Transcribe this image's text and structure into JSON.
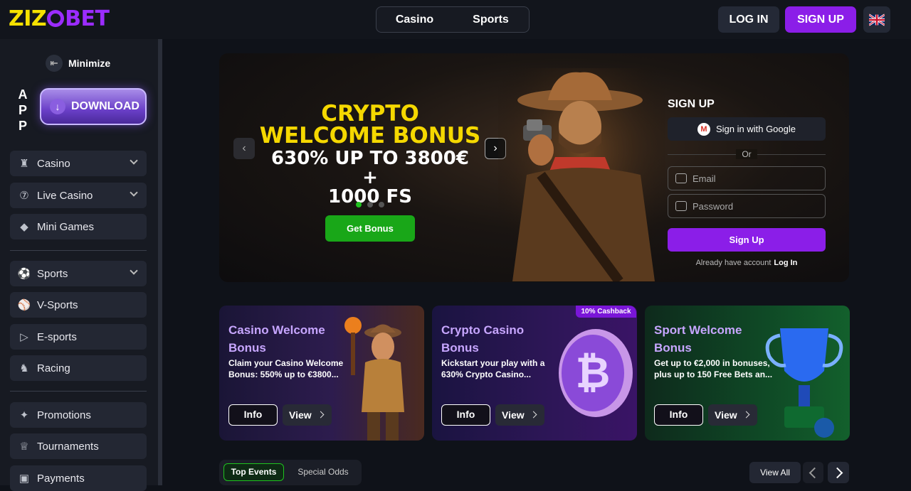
{
  "header": {
    "logo": {
      "part1": "ZIZ",
      "part2": "BET"
    },
    "nav_tabs": [
      "Casino",
      "Sports"
    ],
    "login_label": "LOG IN",
    "signup_label": "SIGN UP"
  },
  "sidebar": {
    "minimize_label": "Minimize",
    "app_letters": [
      "A",
      "P",
      "P"
    ],
    "download_label": "DOWNLOAD",
    "groups": [
      [
        {
          "label": "Casino",
          "icon": "casino-icon",
          "expandable": true
        },
        {
          "label": "Live Casino",
          "icon": "live-casino-icon",
          "expandable": true
        },
        {
          "label": "Mini Games",
          "icon": "diamond-icon",
          "expandable": false
        }
      ],
      [
        {
          "label": "Sports",
          "icon": "soccer-ball-icon",
          "expandable": true
        },
        {
          "label": "V-Sports",
          "icon": "virtual-sports-icon",
          "expandable": false
        },
        {
          "label": "E-sports",
          "icon": "play-icon",
          "expandable": false
        },
        {
          "label": "Racing",
          "icon": "horse-icon",
          "expandable": false
        }
      ],
      [
        {
          "label": "Promotions",
          "icon": "megaphone-icon",
          "expandable": false
        },
        {
          "label": "Tournaments",
          "icon": "trophy-icon",
          "expandable": false
        },
        {
          "label": "Payments",
          "icon": "wallet-icon",
          "expandable": false
        }
      ]
    ]
  },
  "hero": {
    "title_line1": "CRYPTO",
    "title_line2": "WELCOME BONUS",
    "subtitle_line1": "630% UP TO 3800€ +",
    "subtitle_line2": "1000 FS",
    "cta_label": "Get Bonus",
    "slides_total": 3,
    "active_slide": 1
  },
  "signup_form": {
    "title": "SIGN UP",
    "google_label": "Sign in with Google",
    "or_label": "Or",
    "email_placeholder": "Email",
    "password_placeholder": "Password",
    "submit_label": "Sign Up",
    "already_text": "Already have account",
    "login_link": "Log In"
  },
  "promo_cards": [
    {
      "title": "Casino Welcome Bonus",
      "desc": "Claim your Casino Welcome Bonus: 550% up to €3800...",
      "info_label": "Info",
      "view_label": "View"
    },
    {
      "title": "Crypto Casino Bonus",
      "desc": "Kickstart your play with a 630% Crypto Casino...",
      "info_label": "Info",
      "view_label": "View",
      "badge": "10% Cashback"
    },
    {
      "title": "Sport Welcome Bonus",
      "desc": "Get up to €2,000 in bonuses, plus up to 150 Free Bets an...",
      "info_label": "Info",
      "view_label": "View"
    }
  ],
  "events_bar": {
    "tabs": [
      "Top Events",
      "Special Odds"
    ],
    "view_all_label": "View All"
  },
  "colors": {
    "brand_yellow": "#f5e100",
    "brand_purple": "#8b1ee8",
    "cta_green": "#19a718",
    "bg": "#0f1219"
  }
}
